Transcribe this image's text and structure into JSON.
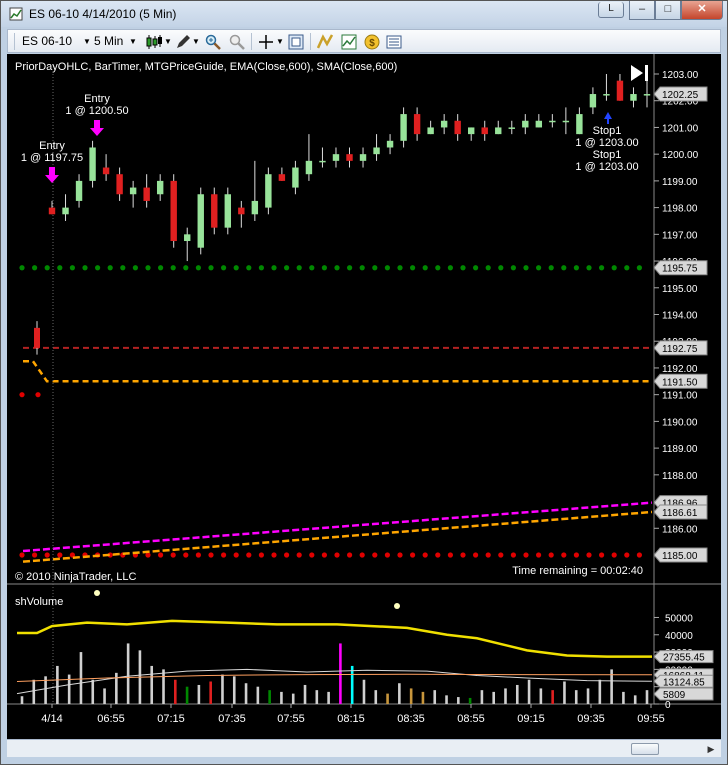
{
  "window": {
    "title": "ES 06-10  4/14/2010 (5 Min)",
    "btn_extra": "L",
    "btn_min": "–",
    "btn_max": "□",
    "btn_close": "✕"
  },
  "toolbar": {
    "instrument": "ES 06-10",
    "interval": "5 Min"
  },
  "chart": {
    "indicators_label": "PriorDayOHLC, BarTimer, MTGPriceGuide, EMA(Close,600), SMA(Close,600)",
    "copyright": "© 2010 NinjaTrader, LLC",
    "time_remaining": "Time remaining = 00:02:40",
    "price_axis": [
      "1203.00",
      "1202.00",
      "1201.00",
      "1200.00",
      "1199.00",
      "1198.00",
      "1197.00",
      "1196.00",
      "1195.00",
      "1194.00",
      "1193.00",
      "1192.00",
      "1191.00",
      "1190.00",
      "1189.00",
      "1188.00",
      "1187.00",
      "1186.00",
      "1185.00"
    ],
    "price_labels": [
      {
        "text": "1202.25",
        "color": "#ffffff"
      },
      {
        "text": "1195.75",
        "color": "#ffffff"
      },
      {
        "text": "1192.75",
        "color": "#ffffff"
      },
      {
        "text": "1191.50",
        "color": "#ffffff"
      },
      {
        "text": "1186.96",
        "color": "#ffffff"
      },
      {
        "text": "1186.61",
        "color": "#ffffff"
      },
      {
        "text": "1185.00",
        "color": "#ffffff"
      }
    ],
    "annotations": {
      "entry1_title": "Entry",
      "entry1_detail": "1 @ 1197.75",
      "entry2_title": "Entry",
      "entry2_detail": "1 @ 1200.50",
      "stop1_title": "Stop1",
      "stop1_detail": "1 @ 1203.00",
      "stop2_title": "Stop1",
      "stop2_detail": "1 @ 1203.00"
    },
    "colors": {
      "up_candle": "#98e39a",
      "down_candle": "#e02020",
      "prior_high": "#b22222",
      "prior_close": "#ffa500",
      "prior_low_dots": "#e00000",
      "prior_open_dots": "#008800",
      "ema": "#ff00ff",
      "sma": "#ffa500"
    }
  },
  "volume_panel": {
    "title": "shVolume",
    "axis": [
      "50000",
      "40000",
      "30000",
      "20000",
      "10000",
      "0"
    ],
    "labels": [
      "27355.45",
      "16868.11",
      "13124.85",
      "5809"
    ]
  },
  "time_axis": [
    "4/14",
    "06:55",
    "07:15",
    "07:35",
    "07:55",
    "08:15",
    "08:35",
    "08:55",
    "09:15",
    "09:35",
    "09:55"
  ],
  "chart_data": {
    "type": "candlestick",
    "candles": [
      {
        "o": 1198.0,
        "h": 1198.25,
        "l": 1197.75,
        "c": 1197.75
      },
      {
        "o": 1197.75,
        "h": 1198.5,
        "l": 1197.5,
        "c": 1198.0
      },
      {
        "o": 1198.25,
        "h": 1199.25,
        "l": 1198.0,
        "c": 1199.0
      },
      {
        "o": 1199.0,
        "h": 1200.5,
        "l": 1198.75,
        "c": 1200.25
      },
      {
        "o": 1199.5,
        "h": 1200.0,
        "l": 1199.0,
        "c": 1199.25
      },
      {
        "o": 1199.25,
        "h": 1199.5,
        "l": 1198.25,
        "c": 1198.5
      },
      {
        "o": 1198.5,
        "h": 1199.0,
        "l": 1198.0,
        "c": 1198.75
      },
      {
        "o": 1198.75,
        "h": 1199.25,
        "l": 1198.0,
        "c": 1198.25
      },
      {
        "o": 1198.5,
        "h": 1199.25,
        "l": 1198.25,
        "c": 1199.0
      },
      {
        "o": 1199.0,
        "h": 1199.25,
        "l": 1196.5,
        "c": 1196.75
      },
      {
        "o": 1196.75,
        "h": 1197.25,
        "l": 1196.0,
        "c": 1197.0
      },
      {
        "o": 1196.5,
        "h": 1198.75,
        "l": 1196.25,
        "c": 1198.5
      },
      {
        "o": 1198.5,
        "h": 1198.75,
        "l": 1197.0,
        "c": 1197.25
      },
      {
        "o": 1197.25,
        "h": 1198.75,
        "l": 1197.0,
        "c": 1198.5
      },
      {
        "o": 1198.0,
        "h": 1198.25,
        "l": 1197.25,
        "c": 1197.75
      },
      {
        "o": 1197.75,
        "h": 1199.75,
        "l": 1197.5,
        "c": 1198.25
      },
      {
        "o": 1198.0,
        "h": 1199.5,
        "l": 1197.75,
        "c": 1199.25
      },
      {
        "o": 1199.25,
        "h": 1199.5,
        "l": 1199.0,
        "c": 1199.0
      },
      {
        "o": 1198.75,
        "h": 1199.75,
        "l": 1198.5,
        "c": 1199.5
      },
      {
        "o": 1199.25,
        "h": 1200.75,
        "l": 1199.0,
        "c": 1199.75
      },
      {
        "o": 1199.75,
        "h": 1200.25,
        "l": 1199.5,
        "c": 1199.75
      },
      {
        "o": 1199.75,
        "h": 1200.25,
        "l": 1199.5,
        "c": 1200.0
      },
      {
        "o": 1200.0,
        "h": 1200.25,
        "l": 1199.5,
        "c": 1199.75
      },
      {
        "o": 1199.75,
        "h": 1200.25,
        "l": 1199.5,
        "c": 1200.0
      },
      {
        "o": 1200.0,
        "h": 1200.75,
        "l": 1199.75,
        "c": 1200.25
      },
      {
        "o": 1200.25,
        "h": 1200.75,
        "l": 1200.0,
        "c": 1200.5
      },
      {
        "o": 1200.5,
        "h": 1201.75,
        "l": 1200.25,
        "c": 1201.5
      },
      {
        "o": 1201.5,
        "h": 1201.75,
        "l": 1200.5,
        "c": 1200.75
      },
      {
        "o": 1200.75,
        "h": 1201.25,
        "l": 1200.75,
        "c": 1201.0
      },
      {
        "o": 1201.0,
        "h": 1201.5,
        "l": 1200.75,
        "c": 1201.25
      },
      {
        "o": 1201.25,
        "h": 1201.5,
        "l": 1200.5,
        "c": 1200.75
      },
      {
        "o": 1200.75,
        "h": 1201.0,
        "l": 1200.5,
        "c": 1201.0
      },
      {
        "o": 1201.0,
        "h": 1201.25,
        "l": 1200.5,
        "c": 1200.75
      },
      {
        "o": 1200.75,
        "h": 1201.25,
        "l": 1200.75,
        "c": 1201.0
      },
      {
        "o": 1201.0,
        "h": 1201.25,
        "l": 1200.75,
        "c": 1201.0
      },
      {
        "o": 1201.0,
        "h": 1201.5,
        "l": 1200.75,
        "c": 1201.25
      },
      {
        "o": 1201.0,
        "h": 1201.5,
        "l": 1201.0,
        "c": 1201.25
      },
      {
        "o": 1201.25,
        "h": 1201.5,
        "l": 1201.0,
        "c": 1201.25
      },
      {
        "o": 1201.25,
        "h": 1201.75,
        "l": 1200.75,
        "c": 1201.25
      },
      {
        "o": 1200.75,
        "h": 1201.75,
        "l": 1200.75,
        "c": 1201.5
      },
      {
        "o": 1201.75,
        "h": 1202.5,
        "l": 1201.5,
        "c": 1202.25
      },
      {
        "o": 1202.25,
        "h": 1203.0,
        "l": 1202.0,
        "c": 1202.25
      },
      {
        "o": 1202.75,
        "h": 1203.0,
        "l": 1202.0,
        "c": 1202.0
      },
      {
        "o": 1202.0,
        "h": 1202.5,
        "l": 1201.75,
        "c": 1202.25
      },
      {
        "o": 1202.25,
        "h": 1202.75,
        "l": 1201.75,
        "c": 1202.25
      }
    ],
    "volume": [
      4500,
      14000,
      16000,
      22000,
      17000,
      30000,
      14000,
      9000,
      18000,
      35000,
      31000,
      22000,
      20000,
      14000,
      10000,
      11000,
      13000,
      17000,
      16000,
      12000,
      10000,
      8000,
      7000,
      6000,
      11000,
      8000,
      7000,
      35000,
      22000,
      14000,
      8000,
      6000,
      12000,
      9000,
      7000,
      8000,
      5000,
      4000,
      3500,
      8000,
      7000,
      9000,
      11000,
      14000,
      9000,
      8000,
      13000,
      8000,
      9000,
      14000,
      20000,
      7000,
      5000,
      8000
    ],
    "volume_colors": [
      "#d0d0d0",
      "#d0d0d0",
      "#d0d0d0",
      "#d0d0d0",
      "#d0d0d0",
      "#d0d0d0",
      "#d0d0d0",
      "#d0d0d0",
      "#d0d0d0",
      "#d0d0d0",
      "#d0d0d0",
      "#d0d0d0",
      "#d0d0d0",
      "#e02020",
      "#008800",
      "#d0d0d0",
      "#e02020",
      "#d0d0d0",
      "#d0d0d0",
      "#d0d0d0",
      "#d0d0d0",
      "#008800",
      "#d0d0d0",
      "#d0d0d0",
      "#d0d0d0",
      "#d0d0d0",
      "#d0d0d0",
      "#ff00ff",
      "#00ffff",
      "#d0d0d0",
      "#d0d0d0",
      "#c8963c",
      "#d0d0d0",
      "#c8963c",
      "#c8963c",
      "#d0d0d0",
      "#d0d0d0",
      "#d0d0d0",
      "#008800",
      "#d0d0d0",
      "#d0d0d0",
      "#d0d0d0",
      "#d0d0d0",
      "#d0d0d0",
      "#d0d0d0",
      "#e02020",
      "#d0d0d0",
      "#d0d0d0",
      "#d0d0d0",
      "#d0d0d0",
      "#d0d0d0",
      "#d0d0d0",
      "#d0d0d0",
      "#d0d0d0"
    ],
    "ylim": [
      1184.5,
      1203.5
    ]
  }
}
